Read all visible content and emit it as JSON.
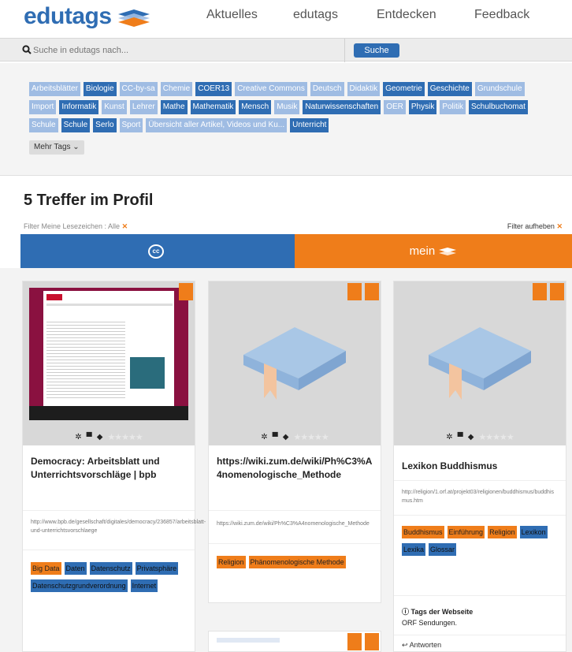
{
  "header": {
    "logo": "edutags",
    "nav": [
      "Aktuelles",
      "edutags",
      "Entdecken",
      "Feedback"
    ]
  },
  "search": {
    "placeholder": "Suche in edutags nach...",
    "button": "Suche"
  },
  "tag_cloud": {
    "tags": [
      {
        "label": "Arbeitsblätter",
        "style": "light"
      },
      {
        "label": "Biologie",
        "style": "dark"
      },
      {
        "label": "CC-by-sa",
        "style": "light"
      },
      {
        "label": "Chemie",
        "style": "light"
      },
      {
        "label": "COER13",
        "style": "dark"
      },
      {
        "label": "Creative Commons",
        "style": "light"
      },
      {
        "label": "Deutsch",
        "style": "light"
      },
      {
        "label": "Didaktik",
        "style": "light"
      },
      {
        "label": "Geometrie",
        "style": "dark"
      },
      {
        "label": "Geschichte",
        "style": "dark"
      },
      {
        "label": "Grundschule",
        "style": "light"
      },
      {
        "label": "Import",
        "style": "light"
      },
      {
        "label": "Informatik",
        "style": "dark"
      },
      {
        "label": "Kunst",
        "style": "light"
      },
      {
        "label": "Lehrer",
        "style": "light"
      },
      {
        "label": "Mathe",
        "style": "dark"
      },
      {
        "label": "Mathematik",
        "style": "dark"
      },
      {
        "label": "Mensch",
        "style": "dark"
      },
      {
        "label": "Musik",
        "style": "light"
      },
      {
        "label": "Naturwissenschaften",
        "style": "dark"
      },
      {
        "label": "OER",
        "style": "light"
      },
      {
        "label": "Physik",
        "style": "dark"
      },
      {
        "label": "Politik",
        "style": "light"
      },
      {
        "label": "Schulbuchomat",
        "style": "dark"
      },
      {
        "label": "Schule",
        "style": "light"
      },
      {
        "label": "Schule",
        "style": "dark"
      },
      {
        "label": "Serlo",
        "style": "dark"
      },
      {
        "label": "Sport",
        "style": "light"
      },
      {
        "label": "Übersicht aller Artikel, Videos und Ku...",
        "style": "light"
      },
      {
        "label": "Unterricht",
        "style": "dark"
      }
    ],
    "more": "Mehr Tags ⌄"
  },
  "results": {
    "title": "5 Treffer im Profil",
    "filter": "Filter Meine Lesezeichen : Alle",
    "filter_close": "✕",
    "filter_reset": "Filter aufheben",
    "filter_reset_close": "✕"
  },
  "toggle": {
    "cc": "cc",
    "mein": "mein"
  },
  "cards": [
    {
      "title": "Democracy: Arbeitsblatt und Unterrichtsvorschläge | bpb",
      "url": "http://www.bpb.de/gesellschaft/digitales/democracy/236857/arbeitsblatt-und-unterrichtsvorschlaege",
      "tags": [
        {
          "label": "Big Data",
          "color": "or"
        },
        {
          "label": "Daten",
          "color": "bl"
        },
        {
          "label": "Datenschutz",
          "color": "bl"
        },
        {
          "label": "Privatsphäre",
          "color": "bl"
        },
        {
          "label": "Datenschutzgrundverordnung",
          "color": "bl"
        },
        {
          "label": "Internet",
          "color": "bl"
        }
      ]
    },
    {
      "title": "https://wiki.zum.de/wiki/Ph%C3%A4nomenologische_Methode",
      "url": "https://wiki.zum.de/wiki/Ph%C3%A4nomenologische_Methode",
      "tags": [
        {
          "label": "Religion",
          "color": "or"
        },
        {
          "label": "Phänomenologische Methode",
          "color": "or"
        }
      ]
    },
    {
      "title": "Lexikon Buddhismus",
      "url": "http://religion/1.orf.at/projekt03/religionen/buddhismus/buddhismus.htm",
      "tags": [
        {
          "label": "Buddhismus",
          "color": "or"
        },
        {
          "label": "Einführung",
          "color": "or"
        },
        {
          "label": "Religion",
          "color": "or"
        },
        {
          "label": "Lexikon",
          "color": "bl"
        },
        {
          "label": "Lexika",
          "color": "bl"
        },
        {
          "label": "Glossar",
          "color": "bl"
        }
      ],
      "site_tags_title": "Tags der Webseite",
      "site_tags_value": "ORF Sendungen.",
      "reply": "Antworten"
    }
  ],
  "colors": {
    "brand_blue": "#2f6db3",
    "brand_orange": "#ef7d1a",
    "tag_light": "#9fbce3"
  }
}
